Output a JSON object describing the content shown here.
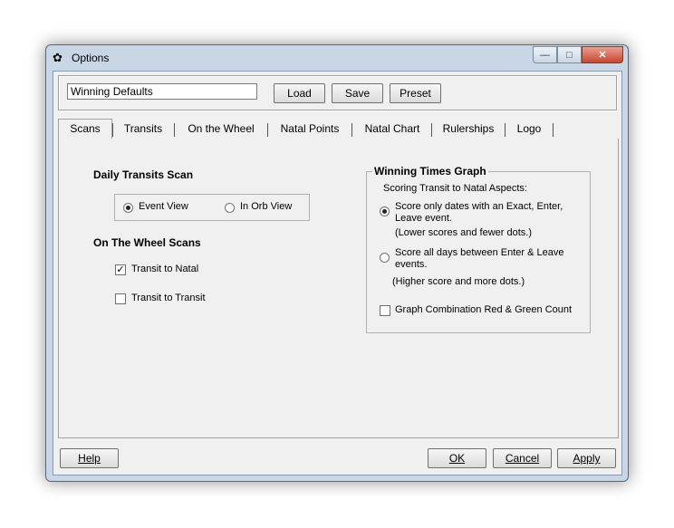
{
  "window": {
    "title": "Options"
  },
  "toolbar": {
    "profile_value": "Winning Defaults",
    "load_label": "Load",
    "save_label": "Save",
    "preset_label": "Preset"
  },
  "tabs": [
    "Scans",
    "Transits",
    "On the Wheel",
    "Natal Points",
    "Natal Chart",
    "Rulerships",
    "Logo"
  ],
  "active_tab": "Scans",
  "scans": {
    "daily_title": "Daily Transits Scan",
    "event_view": "Event View",
    "in_orb_view": "In Orb View",
    "selected_view": "Event View",
    "wheel_title": "On The Wheel Scans",
    "transit_to_natal": "Transit to Natal",
    "transit_to_natal_checked": true,
    "transit_to_transit": "Transit to Transit",
    "transit_to_transit_checked": false
  },
  "graph": {
    "title": "Winning Times Graph",
    "subtitle": "Scoring Transit to Natal Aspects:",
    "opt1_line1": "Score only dates with an Exact, Enter,",
    "opt1_line2": "Leave event.",
    "opt1_note": "(Lower scores and fewer dots.)",
    "opt2_line1": "Score  all days between Enter &  Leave",
    "opt2_line2": "events.",
    "opt2_note": "(Higher score and more dots.)",
    "combo_label": "Graph Combination Red & Green Count",
    "combo_checked": false
  },
  "footer": {
    "help_label": "Help",
    "ok_label": "OK",
    "cancel_label": "Cancel",
    "apply_label": "Apply"
  }
}
